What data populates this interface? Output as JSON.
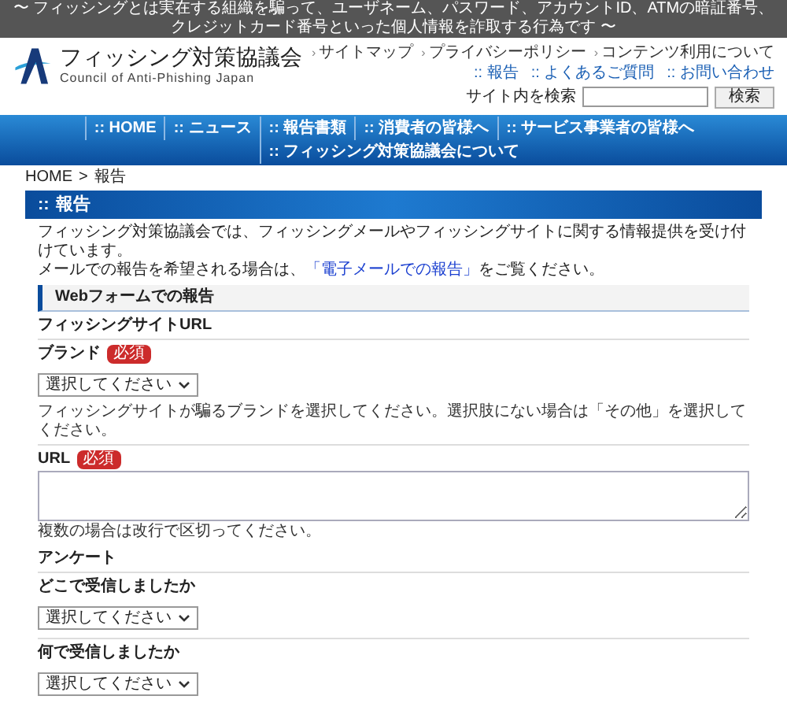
{
  "top_banner": "〜 フィッシングとは実在する組織を騙って、ユーザネーム、パスワード、アカウントID、ATMの暗証番号、クレジットカード番号といった個人情報を詐取する行為です 〜",
  "logo": {
    "title": "フィッシング対策協議会",
    "subtitle": "Council of Anti-Phishing Japan"
  },
  "utility_links": [
    {
      "marker": "›",
      "label": "サイトマップ"
    },
    {
      "marker": "›",
      "label": "プライバシーポリシー"
    },
    {
      "marker": "›",
      "label": "コンテンツ利用について"
    }
  ],
  "quick_links": [
    ":: 報告",
    ":: よくあるご質問",
    ":: お問い合わせ"
  ],
  "search": {
    "label": "サイト内を検索",
    "button": "検索"
  },
  "nav": [
    {
      "label": ":: HOME"
    },
    {
      "label": ":: ニュース"
    },
    {
      "label": ":: 報告書類"
    },
    {
      "label": ":: 消費者の皆様へ"
    },
    {
      "label": ":: サービス事業者の皆様へ"
    },
    {
      "label": ":: フィッシング対策協議会について"
    }
  ],
  "breadcrumb": {
    "items": [
      "HOME",
      "報告"
    ],
    "separator": ">"
  },
  "page_title": {
    "marker": "::",
    "text": "報告"
  },
  "intro": {
    "line1": "フィッシング対策協議会では、フィッシングメールやフィッシングサイトに関する情報提供を受け付けています。",
    "line2_before": "メールでの報告を希望される場合は、",
    "line2_link": "「電子メールでの報告」",
    "line2_after": "をご覧ください。"
  },
  "section_title": "Webフォームでの報告",
  "groups": [
    {
      "heading": "フィッシングサイトURL",
      "fields": [
        {
          "kind": "select",
          "label": "ブランド",
          "badge": "必須",
          "value": "選択してください",
          "hint": "フィッシングサイトが騙るブランドを選択してください。選択肢にない場合は「その他」を選択してください。"
        },
        {
          "kind": "textarea",
          "label": "URL",
          "badge": "必須",
          "hint": "複数の場合は改行で区切ってください。"
        }
      ]
    },
    {
      "heading": "アンケート",
      "fields": [
        {
          "kind": "select",
          "label": "どこで受信しましたか",
          "value": "選択してください"
        },
        {
          "kind": "select",
          "label": "何で受信しましたか",
          "value": "選択してください"
        }
      ]
    }
  ]
}
